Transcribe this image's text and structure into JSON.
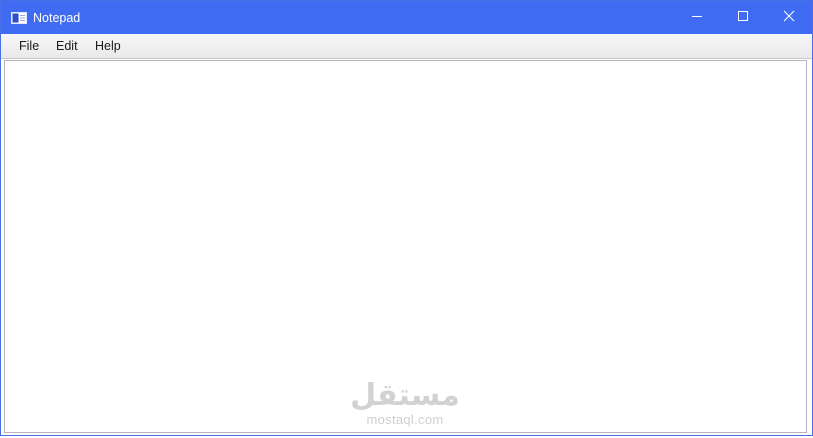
{
  "window": {
    "title": "Notepad",
    "app_icon": "notepad-app-icon",
    "controls": {
      "minimize_icon": "minimize-icon",
      "maximize_icon": "maximize-icon",
      "close_icon": "close-icon"
    },
    "titlebar_color": "#3f6cf3"
  },
  "menubar": {
    "items": [
      {
        "label": "File"
      },
      {
        "label": "Edit"
      },
      {
        "label": "Help"
      }
    ]
  },
  "editor": {
    "content": ""
  },
  "watermark": {
    "arabic": "مستقل",
    "latin": "mostaql.com"
  }
}
